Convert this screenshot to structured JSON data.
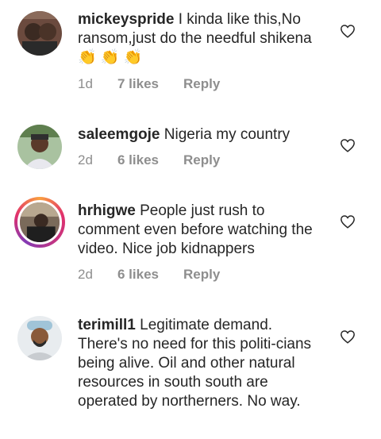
{
  "comments": [
    {
      "username": "mickeyspride",
      "text": "I kinda like this,No ransom,just do the needful shikena 👏 👏 👏",
      "time": "1d",
      "likes": "7 likes",
      "reply": "Reply"
    },
    {
      "username": "saleemgoje",
      "text": "Nigeria my country",
      "time": "2d",
      "likes": "6 likes",
      "reply": "Reply"
    },
    {
      "username": "hrhigwe",
      "text": "People just rush to comment even before watching the video. Nice job kidnappers",
      "time": "2d",
      "likes": "6 likes",
      "reply": "Reply"
    },
    {
      "username": "terimill1",
      "text": "Legitimate demand. There's no need for this politi-cians being alive.  Oil and other natural resources in south south are operated by northerners.  No way.",
      "time": "",
      "likes": "",
      "reply": ""
    }
  ],
  "icons": {
    "like": "heart-outline-icon"
  },
  "colors": {
    "text": "#262626",
    "meta": "#8e8e8e",
    "story_ring": "#e1306c"
  }
}
